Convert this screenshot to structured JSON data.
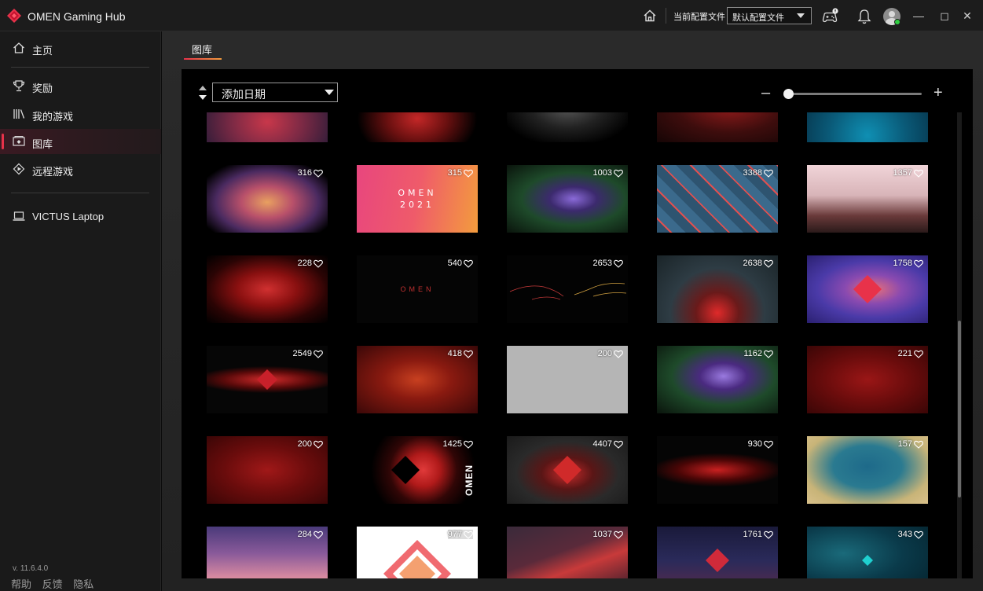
{
  "app": {
    "title": "OMEN Gaming Hub"
  },
  "titlebar": {
    "current_profile_label": "当前配置文件",
    "profile_value": "默认配置文件",
    "icons": [
      "home-icon",
      "gamepad-notification-icon",
      "bell-icon",
      "avatar",
      "minimize-icon",
      "maximize-icon",
      "close-icon"
    ]
  },
  "sidebar": {
    "items": [
      {
        "label": "主页",
        "icon": "home-icon"
      },
      {
        "label": "奖励",
        "icon": "trophy-icon"
      },
      {
        "label": "我的游戏",
        "icon": "library-icon"
      },
      {
        "label": "图库",
        "icon": "gallery-icon",
        "active": true
      },
      {
        "label": "远程游戏",
        "icon": "remote-play-icon"
      },
      {
        "label": "VICTUS Laptop",
        "icon": "laptop-icon"
      }
    ],
    "version": "v. 11.6.4.0",
    "footer": {
      "help": "帮助",
      "feedback": "反馈",
      "privacy": "隐私"
    }
  },
  "main": {
    "tab": "图库",
    "sort": {
      "value": "添加日期"
    },
    "zoom": {
      "level": 0.0
    },
    "gallery_rows": [
      [
        {
          "likes": ""
        },
        {
          "likes": ""
        },
        {
          "likes": ""
        },
        {
          "likes": ""
        },
        {
          "likes": ""
        }
      ],
      [
        {
          "likes": "316"
        },
        {
          "likes": "315"
        },
        {
          "likes": "1003"
        },
        {
          "likes": "3388"
        },
        {
          "likes": "1357"
        }
      ],
      [
        {
          "likes": "228"
        },
        {
          "likes": "540"
        },
        {
          "likes": "2653"
        },
        {
          "likes": "2638"
        },
        {
          "likes": "1758"
        }
      ],
      [
        {
          "likes": "2549"
        },
        {
          "likes": "418"
        },
        {
          "likes": "200"
        },
        {
          "likes": "1162"
        },
        {
          "likes": "221"
        }
      ],
      [
        {
          "likes": "200"
        },
        {
          "likes": "1425"
        },
        {
          "likes": "4407"
        },
        {
          "likes": "930"
        },
        {
          "likes": "157"
        }
      ],
      [
        {
          "likes": "284"
        },
        {
          "likes": "977"
        },
        {
          "likes": "1037"
        },
        {
          "likes": "1761"
        },
        {
          "likes": "343"
        }
      ]
    ],
    "tile_art": {
      "omen_2021_title": "OMEN",
      "omen_2021_year": "2021",
      "omen_wordmark": "OMEN",
      "omen_dots": "OMEN"
    }
  },
  "colors": {
    "accent": "#e8324a",
    "accent2": "#f39c3d",
    "bg": "#0b0b0b",
    "sidebar": "#1a1a1a"
  }
}
